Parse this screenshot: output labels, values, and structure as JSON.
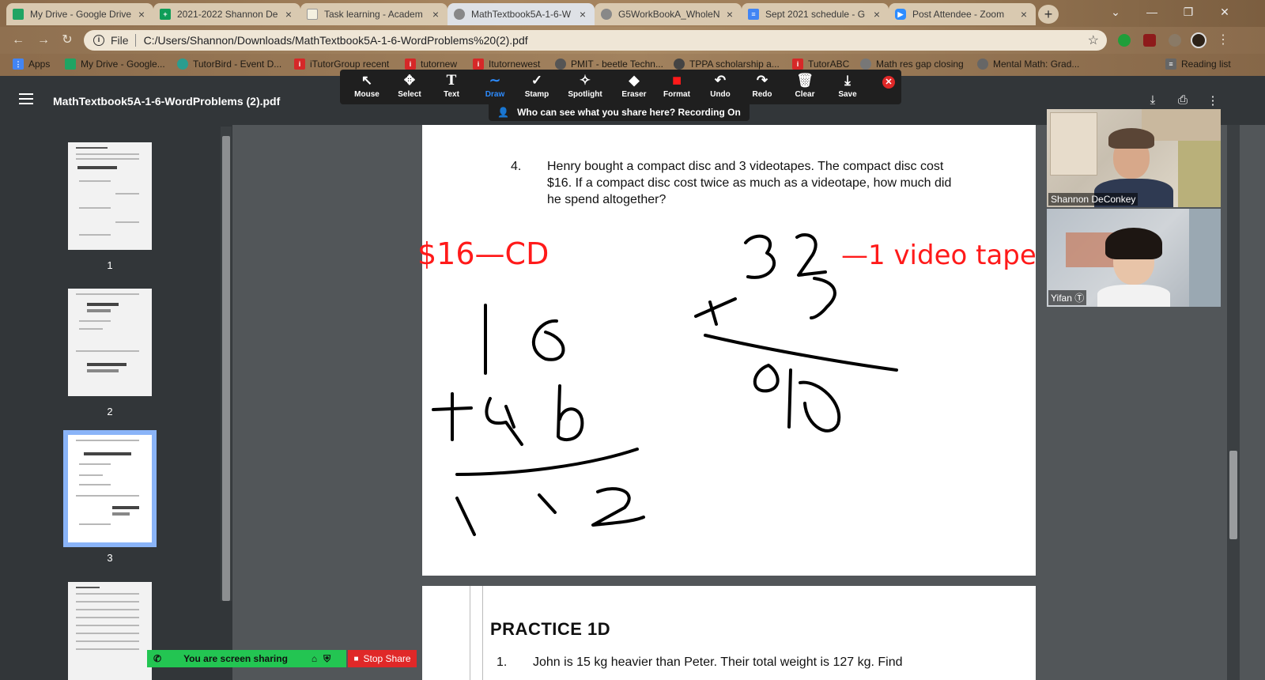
{
  "tabs": [
    {
      "title": "My Drive - Google Drive",
      "color": "#1fa463",
      "active": false
    },
    {
      "title": "2021-2022 Shannon De",
      "color": "#0f9d58",
      "active": false
    },
    {
      "title": "Task learning - Academ",
      "color": "#fbbc04",
      "active": false
    },
    {
      "title": "MathTextbook5A-1-6-W",
      "color": "#888888",
      "active": true
    },
    {
      "title": "G5WorkBookA_WholeN",
      "color": "#888888",
      "active": false
    },
    {
      "title": "Sept 2021 schedule - G",
      "color": "#4285f4",
      "active": false
    },
    {
      "title": "Post Attendee - Zoom",
      "color": "#2d8cff",
      "active": false
    }
  ],
  "address": {
    "file_label": "File",
    "url": "C:/Users/Shannon/Downloads/MathTextbook5A-1-6-WordProblems%20(2).pdf"
  },
  "bookmarks": [
    {
      "label": "Apps",
      "color": "#4285f4"
    },
    {
      "label": "My Drive - Google...",
      "color": "#1fa463"
    },
    {
      "label": "TutorBird - Event D...",
      "color": "#2a9d8f"
    },
    {
      "label": "iTutorGroup recent",
      "color": "#d62828"
    },
    {
      "label": "tutornew",
      "color": "#d62828"
    },
    {
      "label": "Itutornewest",
      "color": "#d62828"
    },
    {
      "label": "PMIT - beetle Techn...",
      "color": "#555555"
    },
    {
      "label": "TPPA scholarship a...",
      "color": "#444444"
    },
    {
      "label": "TutorABC",
      "color": "#d62828"
    },
    {
      "label": "Math res gap closing",
      "color": "#777777"
    },
    {
      "label": "Mental Math: Grad...",
      "color": "#666666"
    },
    {
      "label": "Reading list",
      "color": "#666666"
    }
  ],
  "pdf": {
    "title": "MathTextbook5A-1-6-WordProblems (2).pdf",
    "thumbnails": [
      {
        "number": "1"
      },
      {
        "number": "2"
      },
      {
        "number": "3"
      }
    ]
  },
  "zoom_toolbar": {
    "tools": [
      {
        "label": "Mouse",
        "icon": "↖"
      },
      {
        "label": "Select",
        "icon": "✚"
      },
      {
        "label": "Text",
        "icon": "T"
      },
      {
        "label": "Draw",
        "icon": "∼"
      },
      {
        "label": "Stamp",
        "icon": "✓"
      },
      {
        "label": "Spotlight",
        "icon": "✧"
      },
      {
        "label": "Eraser",
        "icon": "◆"
      },
      {
        "label": "Format",
        "icon": "■"
      },
      {
        "label": "Undo",
        "icon": "↶"
      },
      {
        "label": "Redo",
        "icon": "↷"
      },
      {
        "label": "Clear",
        "icon": "▥"
      },
      {
        "label": "Save",
        "icon": "⤓"
      }
    ],
    "active_tool": "Draw",
    "recording_notice": "Who can see what you share here? Recording On"
  },
  "document": {
    "problem_number": "4.",
    "problem_text": "Henry bought a compact disc and 3 videotapes. The compact disc cost $16. If a compact disc cost twice as much as a videotape, how much did he spend altogether?",
    "practice_title": "PRACTICE 1D",
    "practice_number": "1.",
    "practice_text": "John is 15 kg heavier than Peter. Their total weight is 127 kg. Find"
  },
  "annotations": {
    "red_left": "$16—CD",
    "red_right": "—1 video tape",
    "ink_color_red": "#ff1a1a",
    "ink_color_black": "#000000"
  },
  "video": {
    "participants": [
      {
        "name": "Shannon DeConkey"
      },
      {
        "name": "Yifan Ⓣ"
      }
    ]
  },
  "share": {
    "status": "You are screen sharing",
    "stop_label": "Stop Share"
  }
}
